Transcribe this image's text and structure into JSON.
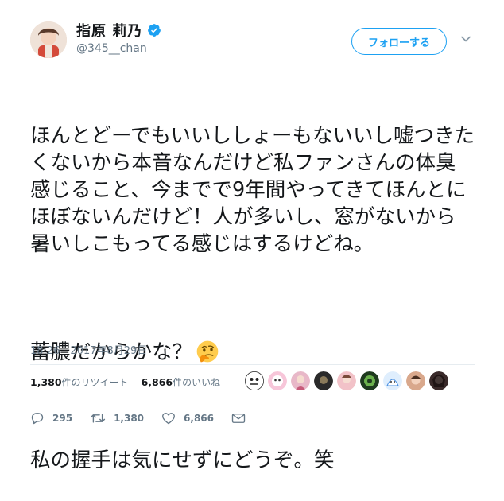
{
  "user": {
    "display_name": "指原 莉乃",
    "handle": "@345__chan",
    "verified": true
  },
  "follow_button": {
    "label": "フォローする"
  },
  "tweet": {
    "paragraphs": [
      "ほんとどーでもいいししょーもないいし嘘つきたくないから本音なんだけど私ファンさんの体臭感じること、今までで9年間やってきてほんとにほぼないんだけど！人が多いし、窓がないから暑いしこもってる感じはするけどね。",
      "蓄膿だからかな？",
      "私の握手は気にせずにどうぞ。笑"
    ],
    "emoji_after_paragraph_2": "thinking-face-emoji",
    "timestamp": "18:26 - 2017年8月29日"
  },
  "stats": {
    "retweets_num": "1,380",
    "retweets_label": "件のリツイート",
    "likes_num": "6,866",
    "likes_label": "件のいいね"
  },
  "likers_count_shown": 9,
  "actions": {
    "reply_count": "295",
    "retweet_count": "1,380",
    "like_count": "6,866"
  },
  "colors": {
    "accent": "#1da1f2",
    "secondary_text": "#657786",
    "divider": "#e6ecf0"
  }
}
